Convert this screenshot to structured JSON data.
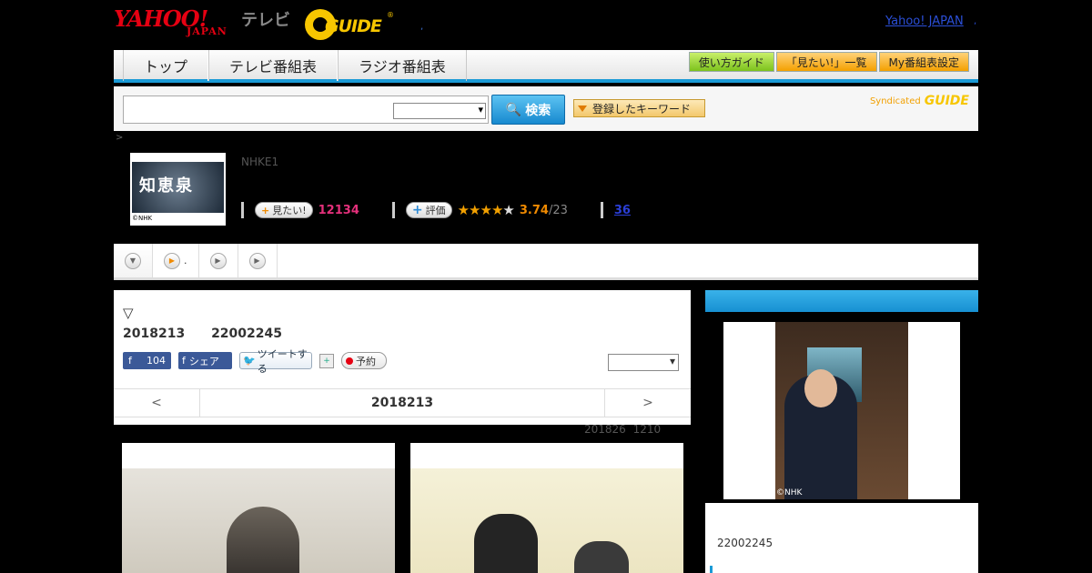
{
  "header": {
    "yahoo": "YAHOO!",
    "japan": "JAPAN",
    "tv": "テレビ",
    "gguide": "GUIDE",
    "reg": "®",
    "yj_link": "Yahoo! JAPAN"
  },
  "nav": {
    "tabs": [
      "トップ",
      "テレビ番組表",
      "ラジオ番組表"
    ],
    "buttons": [
      "使い方ガイド",
      "「見たい!」一覧",
      "My番組表設定"
    ]
  },
  "search": {
    "button": "検索",
    "keyword": "登録したキーワード",
    "syndicated": "Syndicated",
    "logo": "GUIDE"
  },
  "breadcrumb": ">",
  "program": {
    "thumb_title": "知恵泉",
    "thumb_credit": "©NHK",
    "channel": "NHKE1",
    "want_label": "見たい!",
    "want_count": "12134",
    "rate_label": "評価",
    "stars": "★★★★",
    "stars_off": "★",
    "score": "3.74",
    "votes": "/23",
    "reviews": "36"
  },
  "subtabs": [
    {
      "icon": "▼",
      "label": ""
    },
    {
      "icon": "▶",
      "label": "."
    },
    {
      "icon": "▶",
      "label": ""
    },
    {
      "icon": "▶",
      "label": ""
    }
  ],
  "panel": {
    "tri": "▽",
    "date_line": "2018213 22002245",
    "fb_count": "104",
    "share": "シェア",
    "tweet": "ツイートする",
    "reserve": "予約",
    "prev": "<",
    "current": "2018213",
    "next": ">",
    "note": "201826 1210"
  },
  "side": {
    "credit": "©NHK",
    "time": "22002245"
  }
}
